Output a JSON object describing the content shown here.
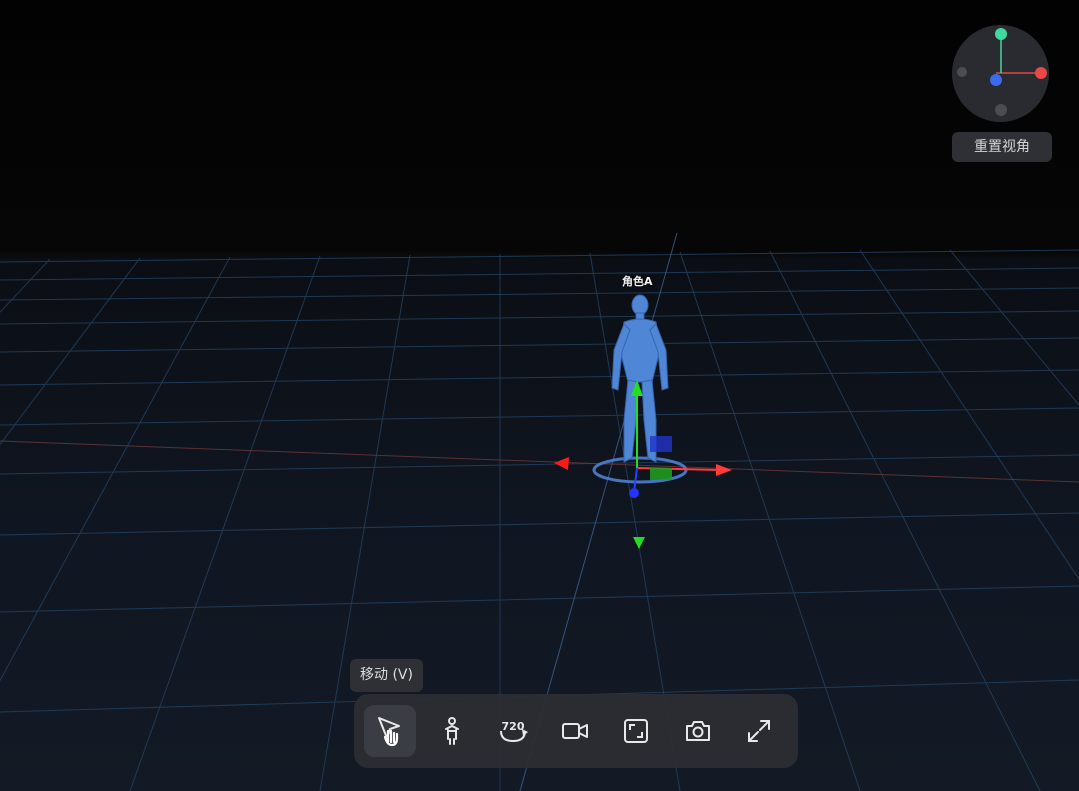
{
  "scene": {
    "character_label": "角色A"
  },
  "view_controls": {
    "reset_view_label": "重置视角"
  },
  "tooltip": {
    "text": "移动 (V)"
  },
  "toolbar": {
    "tools": [
      {
        "icon": "move-cursor-icon",
        "active": true
      },
      {
        "icon": "person-icon",
        "active": false
      },
      {
        "icon": "rotate-720-icon",
        "icon_text": "720",
        "active": false
      },
      {
        "icon": "video-camera-icon",
        "active": false
      },
      {
        "icon": "frame-icon",
        "active": false
      },
      {
        "icon": "camera-icon",
        "active": false
      },
      {
        "icon": "expand-icon",
        "active": false
      }
    ]
  },
  "colors": {
    "x_axis": "#ff3b3b",
    "y_axis": "#22dd22",
    "z_axis": "#2244ff",
    "character": "#4f86d6",
    "grid": "#2c4a6e"
  }
}
